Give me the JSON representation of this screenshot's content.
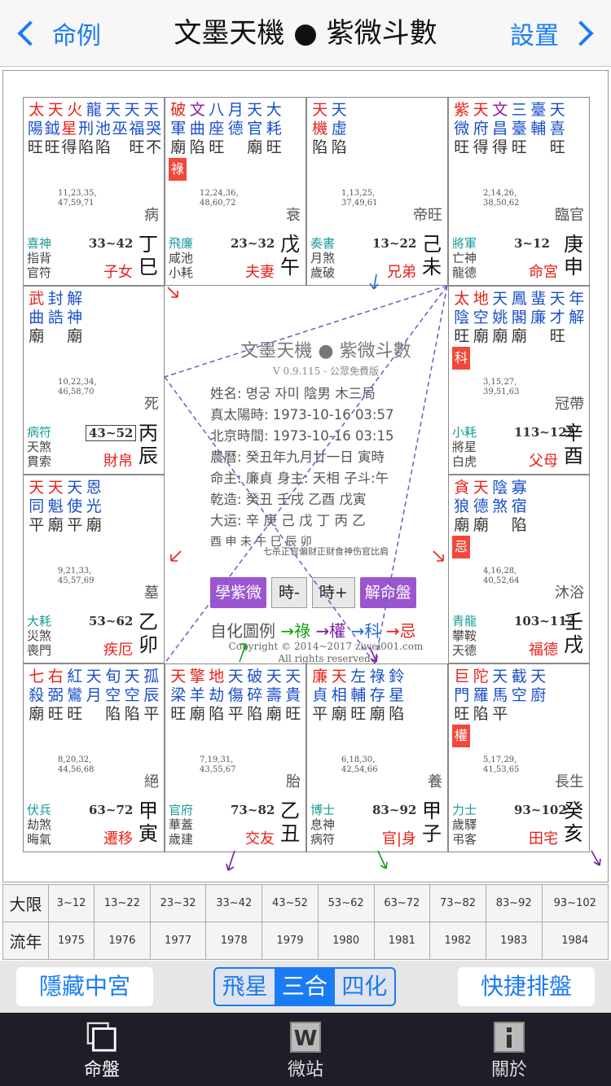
{
  "nav": {
    "back_label": "命例",
    "title": "文墨天機 ● 紫微斗數",
    "settings_label": "設置"
  },
  "cells": [
    {
      "pos": [
        0,
        0
      ],
      "rows": [
        [
          [
            "太",
            "r"
          ],
          [
            "天",
            "r"
          ],
          [
            "火",
            "r"
          ],
          [
            "龍",
            "b"
          ],
          [
            "天",
            "b"
          ],
          [
            "天",
            "b"
          ],
          [
            "天",
            "b"
          ]
        ],
        [
          [
            "陽",
            "b"
          ],
          [
            "鉞",
            "b"
          ],
          [
            "星",
            "r"
          ],
          [
            "刑",
            "b"
          ],
          [
            "池",
            "b"
          ],
          [
            "巫",
            "b"
          ],
          [
            "福",
            "b"
          ],
          [
            "哭",
            "b"
          ]
        ],
        [
          [
            "旺",
            "g"
          ],
          [
            "旺",
            "g"
          ],
          [
            "得",
            "g"
          ],
          [
            "陷",
            "g"
          ],
          [
            "陷",
            "g"
          ],
          [
            "",
            ""
          ],
          [
            "旺",
            "g"
          ],
          [
            "不",
            "g"
          ]
        ]
      ],
      "ages": [
        "11,23,35,",
        "47,59,71"
      ],
      "life": "病",
      "gods": [
        "喜神",
        "指背",
        "官符"
      ],
      "range": "33~42",
      "palace": "子女",
      "stem": [
        "丁",
        "巳"
      ]
    },
    {
      "pos": [
        1,
        0
      ],
      "rows": [
        [
          [
            "破",
            "r"
          ],
          [
            "文",
            "p"
          ],
          [
            "八",
            "b"
          ],
          [
            "月",
            "b"
          ],
          [
            "天",
            "b"
          ],
          [
            "大",
            "b"
          ]
        ],
        [
          [
            "軍",
            "b"
          ],
          [
            "曲",
            "b"
          ],
          [
            "座",
            "b"
          ],
          [
            "德",
            "b"
          ],
          [
            "官",
            "b"
          ],
          [
            "耗",
            "b"
          ]
        ],
        [
          [
            "廟",
            "g"
          ],
          [
            "陷",
            "g"
          ],
          [
            "旺",
            "g"
          ],
          [
            "",
            ""
          ],
          [
            "廟",
            "g"
          ],
          [
            "旺",
            "g"
          ]
        ]
      ],
      "tag": "祿",
      "ages": [
        "12,24,36,",
        "48,60,72"
      ],
      "life": "衰",
      "gods": [
        "飛廉",
        "咸池",
        "小耗"
      ],
      "range": "23~32",
      "palace": "夫妻",
      "stem": [
        "戊",
        "午"
      ]
    },
    {
      "pos": [
        2,
        0
      ],
      "rows": [
        [
          [
            "天",
            "r"
          ],
          [
            "天",
            "b"
          ]
        ],
        [
          [
            "機",
            "r"
          ],
          [
            "虛",
            "b"
          ]
        ],
        [
          [
            "陷",
            "g"
          ],
          [
            "陷",
            "g"
          ]
        ]
      ],
      "ages": [
        "1,13,25,",
        "37,49,61"
      ],
      "life": "帝旺",
      "gods": [
        "奏書",
        "月煞",
        "歲破"
      ],
      "range": "13~22",
      "palace": "兄弟",
      "stem": [
        "己",
        "未"
      ]
    },
    {
      "pos": [
        3,
        0
      ],
      "rows": [
        [
          [
            "紫",
            "r"
          ],
          [
            "天",
            "r"
          ],
          [
            "文",
            "p"
          ],
          [
            "三",
            "b"
          ],
          [
            "臺",
            "b"
          ],
          [
            "天",
            "b"
          ]
        ],
        [
          [
            "微",
            "b"
          ],
          [
            "府",
            "b"
          ],
          [
            "昌",
            "b"
          ],
          [
            "臺",
            "b"
          ],
          [
            "輔",
            "b"
          ],
          [
            "喜",
            "b"
          ]
        ],
        [
          [
            "旺",
            "g"
          ],
          [
            "得",
            "g"
          ],
          [
            "得",
            "g"
          ],
          [
            "旺",
            "g"
          ],
          [
            "",
            ""
          ],
          [
            "旺",
            "g"
          ]
        ]
      ],
      "ages": [
        "2,14,26,",
        "38,50,62"
      ],
      "life": "臨官",
      "gods": [
        "將軍",
        "亡神",
        "龍德"
      ],
      "range": "3~12",
      "palace": "命宮",
      "stem": [
        "庚",
        "申"
      ]
    },
    {
      "pos": [
        0,
        1
      ],
      "rows": [
        [
          [
            "武",
            "r"
          ],
          [
            "封",
            "b"
          ],
          [
            "解",
            "b"
          ]
        ],
        [
          [
            "曲",
            "b"
          ],
          [
            "誥",
            "b"
          ],
          [
            "神",
            "b"
          ]
        ],
        [
          [
            "廟",
            "g"
          ],
          [
            "",
            ""
          ],
          [
            "廟",
            "g"
          ]
        ]
      ],
      "ages": [
        "10,22,34,",
        "46,58,70"
      ],
      "life": "死",
      "gods": [
        "病符",
        "天煞",
        "貫索"
      ],
      "range": "43~52",
      "boxed": true,
      "palace": "財帛",
      "stem": [
        "丙",
        "辰"
      ]
    },
    {
      "pos": [
        3,
        1
      ],
      "rows": [
        [
          [
            "太",
            "r"
          ],
          [
            "地",
            "r"
          ],
          [
            "天",
            "b"
          ],
          [
            "鳳",
            "b"
          ],
          [
            "蜚",
            "b"
          ],
          [
            "天",
            "b"
          ],
          [
            "年",
            "b"
          ]
        ],
        [
          [
            "陰",
            "b"
          ],
          [
            "空",
            "b"
          ],
          [
            "姚",
            "b"
          ],
          [
            "閣",
            "b"
          ],
          [
            "廉",
            "b"
          ],
          [
            "才",
            "b"
          ],
          [
            "解",
            "b"
          ]
        ],
        [
          [
            "旺",
            "g"
          ],
          [
            "廟",
            "g"
          ],
          [
            "廟",
            "g"
          ],
          [
            "廟",
            "g"
          ],
          [
            "",
            ""
          ],
          [
            "旺",
            "g"
          ]
        ]
      ],
      "tag": "科",
      "ages": [
        "3,15,27,",
        "39,51,63"
      ],
      "life": "冠帶",
      "gods": [
        "小耗",
        "將星",
        "白虎"
      ],
      "range": "113~122",
      "palace": "父母",
      "stem": [
        "辛",
        "酉"
      ]
    },
    {
      "pos": [
        0,
        2
      ],
      "rows": [
        [
          [
            "天",
            "r"
          ],
          [
            "天",
            "r"
          ],
          [
            "天",
            "b"
          ],
          [
            "恩",
            "b"
          ]
        ],
        [
          [
            "同",
            "b"
          ],
          [
            "魁",
            "b"
          ],
          [
            "使",
            "b"
          ],
          [
            "光",
            "b"
          ]
        ],
        [
          [
            "平",
            "g"
          ],
          [
            "廟",
            "g"
          ],
          [
            "平",
            "g"
          ],
          [
            "廟",
            "g"
          ]
        ]
      ],
      "ages": [
        "9,21,33,",
        "45,57,69"
      ],
      "life": "墓",
      "gods": [
        "大耗",
        "災煞",
        "喪門"
      ],
      "range": "53~62",
      "palace": "疾厄",
      "stem": [
        "乙",
        "卯"
      ]
    },
    {
      "pos": [
        3,
        2
      ],
      "rows": [
        [
          [
            "貪",
            "r"
          ],
          [
            "天",
            "r"
          ],
          [
            "陰",
            "b"
          ],
          [
            "寡",
            "b"
          ]
        ],
        [
          [
            "狼",
            "b"
          ],
          [
            "德",
            "b"
          ],
          [
            "煞",
            "b"
          ],
          [
            "宿",
            "b"
          ]
        ],
        [
          [
            "廟",
            "g"
          ],
          [
            "廟",
            "g"
          ],
          [
            "",
            ""
          ],
          [
            "陷",
            "g"
          ]
        ]
      ],
      "tag": "忌",
      "ages": [
        "4,16,28,",
        "40,52,64"
      ],
      "life": "沐浴",
      "gods": [
        "青龍",
        "攀鞍",
        "天德"
      ],
      "range": "103~112",
      "palace": "福德",
      "stem": [
        "壬",
        "戌"
      ]
    },
    {
      "pos": [
        0,
        3
      ],
      "rows": [
        [
          [
            "七",
            "r"
          ],
          [
            "右",
            "r"
          ],
          [
            "紅",
            "b"
          ],
          [
            "天",
            "b"
          ],
          [
            "旬",
            "b"
          ],
          [
            "天",
            "b"
          ],
          [
            "孤",
            "b"
          ]
        ],
        [
          [
            "殺",
            "b"
          ],
          [
            "弼",
            "b"
          ],
          [
            "鸞",
            "b"
          ],
          [
            "月",
            "b"
          ],
          [
            "空",
            "b"
          ],
          [
            "空",
            "b"
          ],
          [
            "辰",
            "b"
          ]
        ],
        [
          [
            "廟",
            "g"
          ],
          [
            "旺",
            "g"
          ],
          [
            "旺",
            "g"
          ],
          [
            "",
            ""
          ],
          [
            "陷",
            "g"
          ],
          [
            "陷",
            "g"
          ],
          [
            "平",
            "g"
          ]
        ]
      ],
      "ages": [
        "8,20,32,",
        "44,56,68"
      ],
      "life": "絕",
      "gods": [
        "伏兵",
        "劫煞",
        "晦氣"
      ],
      "range": "63~72",
      "palace": "遷移",
      "stem": [
        "甲",
        "寅"
      ]
    },
    {
      "pos": [
        1,
        3
      ],
      "rows": [
        [
          [
            "天",
            "r"
          ],
          [
            "擎",
            "r"
          ],
          [
            "地",
            "r"
          ],
          [
            "天",
            "b"
          ],
          [
            "破",
            "b"
          ],
          [
            "天",
            "b"
          ],
          [
            "天",
            "b"
          ]
        ],
        [
          [
            "梁",
            "b"
          ],
          [
            "羊",
            "b"
          ],
          [
            "劫",
            "b"
          ],
          [
            "傷",
            "b"
          ],
          [
            "碎",
            "b"
          ],
          [
            "壽",
            "b"
          ],
          [
            "貴",
            "b"
          ]
        ],
        [
          [
            "旺",
            "g"
          ],
          [
            "廟",
            "g"
          ],
          [
            "陷",
            "g"
          ],
          [
            "平",
            "g"
          ],
          [
            "陷",
            "g"
          ],
          [
            "廟",
            "g"
          ],
          [
            "旺",
            "g"
          ]
        ]
      ],
      "ages": [
        "7,19,31,",
        "43,55,67"
      ],
      "life": "胎",
      "gods": [
        "官府",
        "華蓋",
        "歲建"
      ],
      "range": "73~82",
      "palace": "交友",
      "stem": [
        "乙",
        "丑"
      ]
    },
    {
      "pos": [
        2,
        3
      ],
      "rows": [
        [
          [
            "廉",
            "r"
          ],
          [
            "天",
            "r"
          ],
          [
            "左",
            "b"
          ],
          [
            "祿",
            "b"
          ],
          [
            "鈴",
            "b"
          ]
        ],
        [
          [
            "貞",
            "b"
          ],
          [
            "相",
            "b"
          ],
          [
            "輔",
            "b"
          ],
          [
            "存",
            "b"
          ],
          [
            "星",
            "b"
          ]
        ],
        [
          [
            "平",
            "g"
          ],
          [
            "廟",
            "g"
          ],
          [
            "旺",
            "g"
          ],
          [
            "廟",
            "g"
          ],
          [
            "陷",
            "g"
          ]
        ]
      ],
      "ages": [
        "6,18,30,",
        "42,54,66"
      ],
      "life": "養",
      "gods": [
        "博士",
        "息神",
        "病符"
      ],
      "range": "83~92",
      "palace": "官|身",
      "stem": [
        "甲",
        "子"
      ]
    },
    {
      "pos": [
        3,
        3
      ],
      "rows": [
        [
          [
            "巨",
            "r"
          ],
          [
            "陀",
            "r"
          ],
          [
            "天",
            "b"
          ],
          [
            "截",
            "b"
          ],
          [
            "天",
            "b"
          ]
        ],
        [
          [
            "門",
            "b"
          ],
          [
            "羅",
            "b"
          ],
          [
            "馬",
            "b"
          ],
          [
            "空",
            "b"
          ],
          [
            "廚",
            "b"
          ]
        ],
        [
          [
            "旺",
            "g"
          ],
          [
            "陷",
            "g"
          ],
          [
            "平",
            "g"
          ]
        ]
      ],
      "tag": "權",
      "ages": [
        "5,17,29,",
        "41,53,65"
      ],
      "life": "長生",
      "gods": [
        "力士",
        "歲驛",
        "弔客"
      ],
      "range": "93~102",
      "palace": "田宅",
      "stem": [
        "癸",
        "亥"
      ]
    }
  ],
  "center": {
    "title": "文墨天機 ● 紫微斗數",
    "version": "V 0.9.115 - 公眾免費版",
    "info": [
      "姓名: 명궁 자미      陰男 木三局",
      "真太陽時: 1973-10-16   03:57",
      "北京時間: 1973-10-16   03:15",
      "農曆: 癸丑年九月廿一日 寅時",
      "命主: 廉貞 身主: 天相 子斗:午",
      "乾造: 癸丑   壬戌   乙酉   戊寅",
      "大运: 辛  庚  己  戊  丁  丙  乙",
      "          酉  申  未  午  巳  辰  卯"
    ],
    "note": "七杀正官偏财正财食神伤官比肩",
    "btn_learn": "學紫微",
    "btn_prev": "時-",
    "btn_next": "時+",
    "btn_decode": "解命盤",
    "legend_label": "自化圖例",
    "legend_lu": "→祿",
    "legend_quan": "→權",
    "legend_ke": "→科",
    "legend_ji": "→忌",
    "copyright_1": "Copyright © 2014~2017 ziwei001.com",
    "copyright_2": "All rights reserved."
  },
  "decades": {
    "row1_label": "大限",
    "row1": [
      "3~12",
      "13~22",
      "23~32",
      "33~42",
      "43~52",
      "53~62",
      "63~72",
      "73~82",
      "83~92",
      "93~102"
    ],
    "row2_label": "流年",
    "row2": [
      "1975",
      "1976",
      "1977",
      "1978",
      "1979",
      "1980",
      "1981",
      "1982",
      "1983",
      "1984"
    ]
  },
  "controls": {
    "hide_label": "隱藏中宮",
    "seg": [
      "飛星",
      "三合",
      "四化"
    ],
    "seg_active": 1,
    "quick_label": "快捷排盤"
  },
  "tabs": [
    {
      "label": "命盤"
    },
    {
      "label": "微站"
    },
    {
      "label": "關於"
    }
  ],
  "colors": {
    "accent": "#1a7cf4",
    "red": "#e8201a",
    "blue": "#1a4fc8",
    "purple": "#9b55cf",
    "tabbar": "#1e1e28"
  }
}
